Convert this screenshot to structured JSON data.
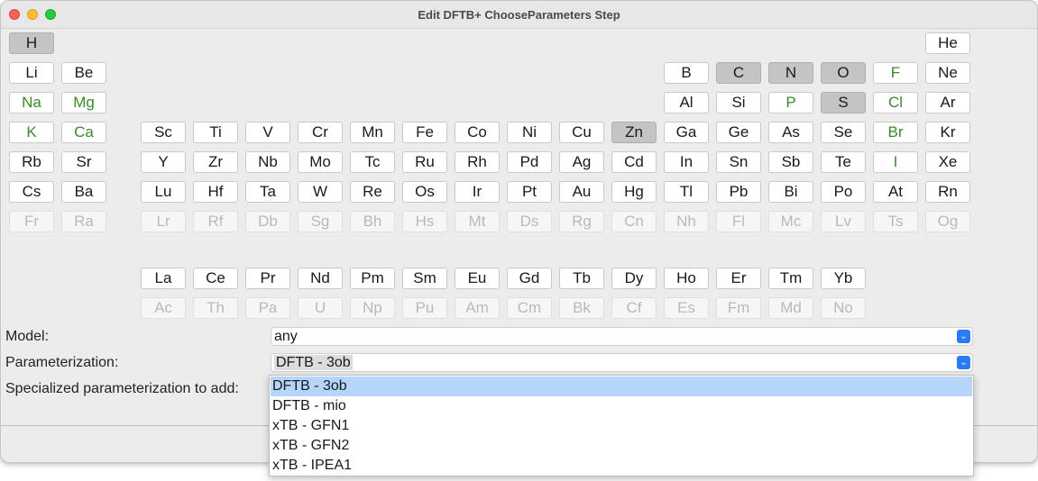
{
  "window": {
    "title": "Edit DFTB+ ChooseParameters Step"
  },
  "periodic_table": {
    "rows": [
      [
        {
          "s": "H",
          "st": "sel"
        },
        {
          "s": "He",
          "st": "n"
        }
      ],
      [
        {
          "s": "Li",
          "st": "n"
        },
        {
          "s": "Be",
          "st": "n"
        },
        {
          "s": "B",
          "st": "n"
        },
        {
          "s": "C",
          "st": "sel"
        },
        {
          "s": "N",
          "st": "sel"
        },
        {
          "s": "O",
          "st": "sel"
        },
        {
          "s": "F",
          "st": "green"
        },
        {
          "s": "Ne",
          "st": "n"
        }
      ],
      [
        {
          "s": "Na",
          "st": "green"
        },
        {
          "s": "Mg",
          "st": "green"
        },
        {
          "s": "Al",
          "st": "n"
        },
        {
          "s": "Si",
          "st": "n"
        },
        {
          "s": "P",
          "st": "green"
        },
        {
          "s": "S",
          "st": "sel"
        },
        {
          "s": "Cl",
          "st": "green"
        },
        {
          "s": "Ar",
          "st": "n"
        }
      ],
      [
        {
          "s": "K",
          "st": "green"
        },
        {
          "s": "Ca",
          "st": "green"
        },
        {
          "s": "Sc",
          "st": "n"
        },
        {
          "s": "Ti",
          "st": "n"
        },
        {
          "s": "V",
          "st": "n"
        },
        {
          "s": "Cr",
          "st": "n"
        },
        {
          "s": "Mn",
          "st": "n"
        },
        {
          "s": "Fe",
          "st": "n"
        },
        {
          "s": "Co",
          "st": "n"
        },
        {
          "s": "Ni",
          "st": "n"
        },
        {
          "s": "Cu",
          "st": "n"
        },
        {
          "s": "Zn",
          "st": "sel"
        },
        {
          "s": "Ga",
          "st": "n"
        },
        {
          "s": "Ge",
          "st": "n"
        },
        {
          "s": "As",
          "st": "n"
        },
        {
          "s": "Se",
          "st": "n"
        },
        {
          "s": "Br",
          "st": "green"
        },
        {
          "s": "Kr",
          "st": "n"
        }
      ],
      [
        {
          "s": "Rb",
          "st": "n"
        },
        {
          "s": "Sr",
          "st": "n"
        },
        {
          "s": "Y",
          "st": "n"
        },
        {
          "s": "Zr",
          "st": "n"
        },
        {
          "s": "Nb",
          "st": "n"
        },
        {
          "s": "Mo",
          "st": "n"
        },
        {
          "s": "Tc",
          "st": "n"
        },
        {
          "s": "Ru",
          "st": "n"
        },
        {
          "s": "Rh",
          "st": "n"
        },
        {
          "s": "Pd",
          "st": "n"
        },
        {
          "s": "Ag",
          "st": "n"
        },
        {
          "s": "Cd",
          "st": "n"
        },
        {
          "s": "In",
          "st": "n"
        },
        {
          "s": "Sn",
          "st": "n"
        },
        {
          "s": "Sb",
          "st": "n"
        },
        {
          "s": "Te",
          "st": "n"
        },
        {
          "s": "I",
          "st": "green"
        },
        {
          "s": "Xe",
          "st": "n"
        }
      ],
      [
        {
          "s": "Cs",
          "st": "n"
        },
        {
          "s": "Ba",
          "st": "n"
        },
        {
          "s": "Lu",
          "st": "n"
        },
        {
          "s": "Hf",
          "st": "n"
        },
        {
          "s": "Ta",
          "st": "n"
        },
        {
          "s": "W",
          "st": "n"
        },
        {
          "s": "Re",
          "st": "n"
        },
        {
          "s": "Os",
          "st": "n"
        },
        {
          "s": "Ir",
          "st": "n"
        },
        {
          "s": "Pt",
          "st": "n"
        },
        {
          "s": "Au",
          "st": "n"
        },
        {
          "s": "Hg",
          "st": "n"
        },
        {
          "s": "Tl",
          "st": "n"
        },
        {
          "s": "Pb",
          "st": "n"
        },
        {
          "s": "Bi",
          "st": "n"
        },
        {
          "s": "Po",
          "st": "n"
        },
        {
          "s": "At",
          "st": "n"
        },
        {
          "s": "Rn",
          "st": "n"
        }
      ],
      [
        {
          "s": "Fr",
          "st": "dim"
        },
        {
          "s": "Ra",
          "st": "dim"
        },
        {
          "s": "Lr",
          "st": "dim"
        },
        {
          "s": "Rf",
          "st": "dim"
        },
        {
          "s": "Db",
          "st": "dim"
        },
        {
          "s": "Sg",
          "st": "dim"
        },
        {
          "s": "Bh",
          "st": "dim"
        },
        {
          "s": "Hs",
          "st": "dim"
        },
        {
          "s": "Mt",
          "st": "dim"
        },
        {
          "s": "Ds",
          "st": "dim"
        },
        {
          "s": "Rg",
          "st": "dim"
        },
        {
          "s": "Cn",
          "st": "dim"
        },
        {
          "s": "Nh",
          "st": "dim"
        },
        {
          "s": "Fl",
          "st": "dim"
        },
        {
          "s": "Mc",
          "st": "dim"
        },
        {
          "s": "Lv",
          "st": "dim"
        },
        {
          "s": "Ts",
          "st": "dim"
        },
        {
          "s": "Og",
          "st": "dim"
        }
      ],
      [
        {
          "s": "La",
          "st": "n"
        },
        {
          "s": "Ce",
          "st": "n"
        },
        {
          "s": "Pr",
          "st": "n"
        },
        {
          "s": "Nd",
          "st": "n"
        },
        {
          "s": "Pm",
          "st": "n"
        },
        {
          "s": "Sm",
          "st": "n"
        },
        {
          "s": "Eu",
          "st": "n"
        },
        {
          "s": "Gd",
          "st": "n"
        },
        {
          "s": "Tb",
          "st": "n"
        },
        {
          "s": "Dy",
          "st": "n"
        },
        {
          "s": "Ho",
          "st": "n"
        },
        {
          "s": "Er",
          "st": "n"
        },
        {
          "s": "Tm",
          "st": "n"
        },
        {
          "s": "Yb",
          "st": "n"
        }
      ],
      [
        {
          "s": "Ac",
          "st": "dim"
        },
        {
          "s": "Th",
          "st": "dim"
        },
        {
          "s": "Pa",
          "st": "dim"
        },
        {
          "s": "U",
          "st": "dim"
        },
        {
          "s": "Np",
          "st": "dim"
        },
        {
          "s": "Pu",
          "st": "dim"
        },
        {
          "s": "Am",
          "st": "dim"
        },
        {
          "s": "Cm",
          "st": "dim"
        },
        {
          "s": "Bk",
          "st": "dim"
        },
        {
          "s": "Cf",
          "st": "dim"
        },
        {
          "s": "Es",
          "st": "dim"
        },
        {
          "s": "Fm",
          "st": "dim"
        },
        {
          "s": "Md",
          "st": "dim"
        },
        {
          "s": "No",
          "st": "dim"
        }
      ]
    ]
  },
  "form": {
    "model_label": "Model:",
    "model_value": "any",
    "param_label": "Parameterization:",
    "param_value": "DFTB - 3ob",
    "specialized_label": "Specialized parameterization to add:"
  },
  "dropdown": {
    "options": [
      "DFTB - 3ob",
      "DFTB - mio",
      "xTB - GFN1",
      "xTB - GFN2",
      "xTB - IPEA1"
    ],
    "highlighted": "DFTB - 3ob"
  },
  "colors": {
    "selected_bg": "#c4c4c4",
    "green_text": "#3b8a2a",
    "highlight": "#b5d5fb",
    "accent": "#2a7bf6"
  },
  "icons": {
    "dropdown": "chevron-down-icon"
  }
}
